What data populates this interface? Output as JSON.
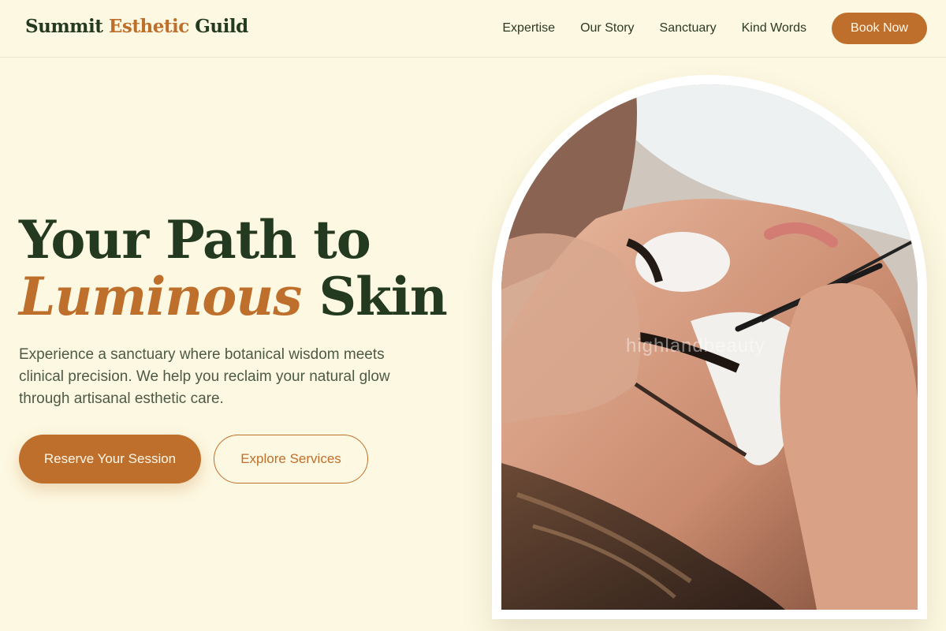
{
  "brand": {
    "part1": "Summit",
    "part2": "Esthetic",
    "part3": "Guild"
  },
  "nav": {
    "links": [
      "Expertise",
      "Our Story",
      "Sanctuary",
      "Kind Words"
    ],
    "cta": "Book Now"
  },
  "hero": {
    "title_line1": "Your Path to",
    "title_accent": "Luminous",
    "title_rest": "Skin",
    "description": "Experience a sanctuary where botanical wisdom meets clinical precision. We help you reclaim your natural glow through artisanal esthetic care.",
    "primary_cta": "Reserve Your Session",
    "secondary_cta": "Explore Services"
  },
  "image": {
    "watermark": "highlandbeauty"
  },
  "colors": {
    "background": "#fdf8e1",
    "accent": "#bf6f2c",
    "heading": "#243a20",
    "body_text": "#4d5a45"
  }
}
